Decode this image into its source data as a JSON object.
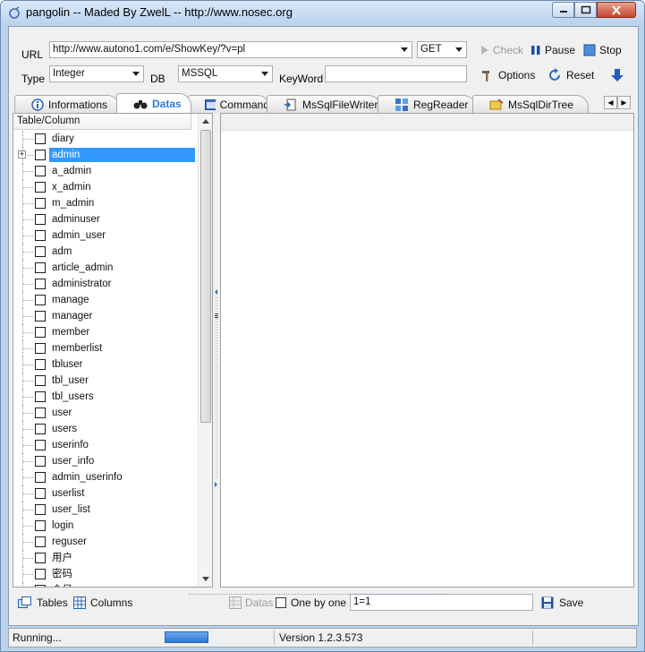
{
  "window": {
    "title": "pangolin -- Maded By ZwelL -- http://www.nosec.org"
  },
  "toolbar": {
    "url_label": "URL",
    "url_value": "http://www.autono1.com/e/ShowKey/?v=pl",
    "method_value": "GET",
    "check_label": "Check",
    "pause_label": "Pause",
    "stop_label": "Stop",
    "type_label": "Type",
    "type_value": "Integer",
    "db_label": "DB",
    "db_value": "MSSQL",
    "keyword_label": "KeyWord",
    "keyword_value": "",
    "options_label": "Options",
    "reset_label": "Reset"
  },
  "tabs": [
    {
      "label": "Informations"
    },
    {
      "label": "Datas"
    },
    {
      "label": "Command"
    },
    {
      "label": "MsSqlFileWriter"
    },
    {
      "label": "RegReader"
    },
    {
      "label": "MsSqlDirTree"
    }
  ],
  "tree": {
    "header": "Table/Column",
    "items": [
      "diary",
      "admin",
      "a_admin",
      "x_admin",
      "m_admin",
      "adminuser",
      "admin_user",
      "adm",
      "article_admin",
      "administrator",
      "manage",
      "manager",
      "member",
      "memberlist",
      "tbluser",
      "tbl_user",
      "tbl_users",
      "user",
      "users",
      "userinfo",
      "user_info",
      "admin_userinfo",
      "userlist",
      "user_list",
      "login",
      "reguser",
      "用户",
      "密码",
      "会员"
    ],
    "selected_index": 1
  },
  "bottom": {
    "tables_label": "Tables",
    "columns_label": "Columns",
    "datas_label": "Datas",
    "one_by_one_label": "One by one",
    "condition_value": "1=1",
    "save_label": "Save"
  },
  "status": {
    "state": "Running...",
    "version": "Version  1.2.3.573"
  },
  "colors": {
    "accent": "#3399ff",
    "frame": "#bcd3ec",
    "close": "#c7442f"
  }
}
